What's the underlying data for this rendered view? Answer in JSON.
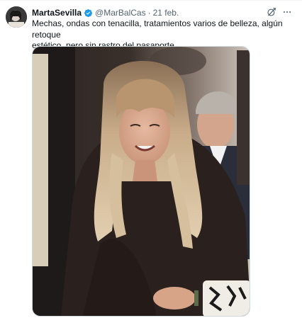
{
  "tweet": {
    "author": {
      "display_name": "MartaSevilla",
      "handle": "@MarBalCas",
      "verified": true,
      "avatar_icon": "avatar-photo"
    },
    "separator": "·",
    "date": "21 feb.",
    "text": "Mechas, ondas con tenacilla, tratamientos varios de belleza, algún retoque\nestético, pero sin rastro del pasaporte.",
    "actions": {
      "grok_icon": "grok-icon",
      "more_icon": "more-options-icon"
    },
    "media": {
      "kind": "photo"
    }
  },
  "colors": {
    "verified_blue": "#1d9bf0",
    "text_primary": "#0f1419",
    "text_secondary": "#536471"
  }
}
